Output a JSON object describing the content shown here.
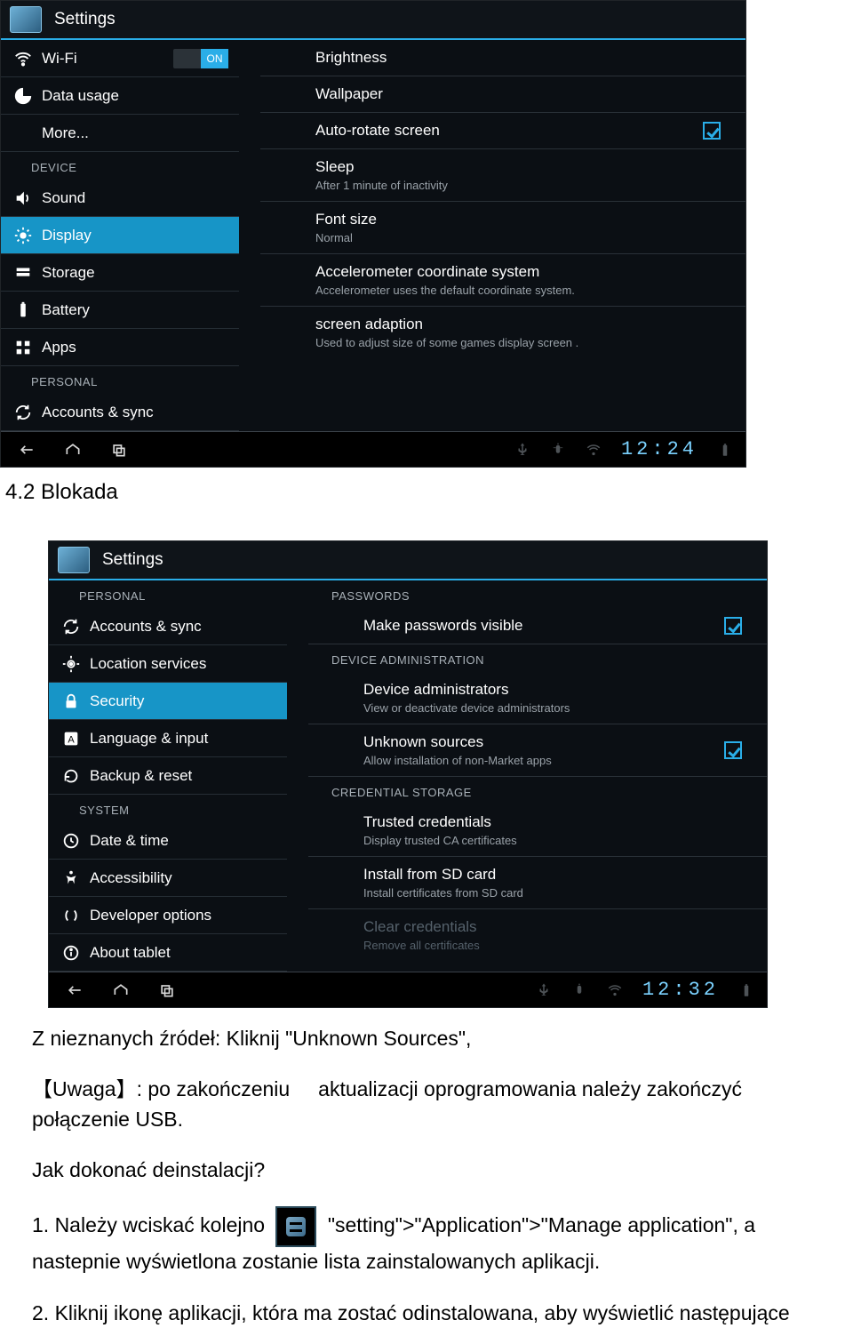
{
  "shot1": {
    "title": "Settings",
    "sidebar": {
      "wireless": {
        "wifi_label": "Wi-Fi",
        "wifi_toggle": "ON",
        "data_usage": "Data usage",
        "more": "More..."
      },
      "device_header": "DEVICE",
      "device": {
        "sound": "Sound",
        "display": "Display",
        "storage": "Storage",
        "battery": "Battery",
        "apps": "Apps"
      },
      "personal_header": "PERSONAL",
      "personal": {
        "accounts": "Accounts & sync"
      }
    },
    "main": {
      "brightness": {
        "t": "Brightness"
      },
      "wallpaper": {
        "t": "Wallpaper"
      },
      "autorotate": {
        "t": "Auto-rotate screen"
      },
      "sleep": {
        "t": "Sleep",
        "s": "After 1 minute of inactivity"
      },
      "fontsize": {
        "t": "Font size",
        "s": "Normal"
      },
      "accel": {
        "t": "Accelerometer coordinate system",
        "s": "Accelerometer uses the default coordinate system."
      },
      "adapt": {
        "t": "screen adaption",
        "s": "Used to adjust size of some games display screen ."
      }
    },
    "navbar_clock": "12:24"
  },
  "doc": {
    "section_heading": "4.2 Blokada"
  },
  "shot2": {
    "title": "Settings",
    "sidebar": {
      "personal_header": "PERSONAL",
      "personal": {
        "accounts": "Accounts & sync",
        "location": "Location services",
        "security": "Security",
        "language": "Language & input",
        "backup": "Backup & reset"
      },
      "system_header": "SYSTEM",
      "system": {
        "date": "Date & time",
        "access": "Accessibility",
        "developer": "Developer options",
        "about": "About tablet"
      }
    },
    "main": {
      "passwords_header": "PASSWORDS",
      "make_visible": {
        "t": "Make passwords visible"
      },
      "devadmin_header": "DEVICE ADMINISTRATION",
      "device_admins": {
        "t": "Device administrators",
        "s": "View or deactivate device administrators"
      },
      "unknown": {
        "t": "Unknown sources",
        "s": "Allow installation of non-Market apps"
      },
      "credstore_header": "CREDENTIAL STORAGE",
      "trusted": {
        "t": "Trusted credentials",
        "s": "Display trusted CA certificates"
      },
      "install_sd": {
        "t": "Install from SD card",
        "s": "Install certificates from SD card"
      },
      "clear": {
        "t": "Clear credentials",
        "s": "Remove all certificates"
      }
    },
    "navbar_clock": "12:32"
  },
  "doc2": {
    "p1": "Z nieznanych źródeł: Kliknij \"Unknown Sources\",",
    "p2a": "【Uwaga】: po zakończeniu",
    "p2b": "aktualizacji oprogramowania należy zakończyć połączenie USB.",
    "p3": "Jak dokonać deinstalacji?",
    "p4a": "1. Należy wciskać kolejno",
    "p4b": "\"setting\">\"Application\">\"Manage application\", a nastepnie wyświetlona zostanie lista zainstalowanych aplikacji.",
    "p5": "2. Kliknij ikonę aplikacji, która ma zostać odinstalowana, aby wyświetlić następujące"
  }
}
